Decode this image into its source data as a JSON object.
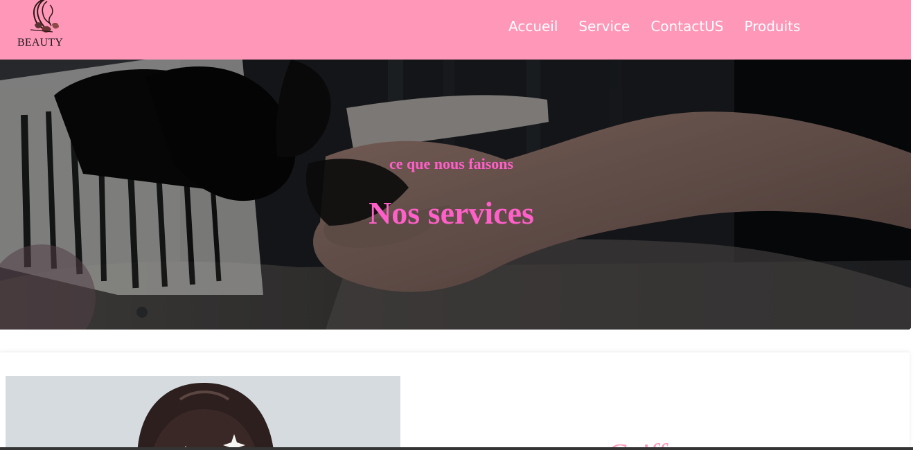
{
  "brand": {
    "name": "BEAUTY",
    "logo_icon": "woman-silhouette-logo-icon"
  },
  "nav": {
    "items": [
      {
        "label": "Accueil"
      },
      {
        "label": "Service"
      },
      {
        "label": "ContactUS"
      },
      {
        "label": "Produits"
      }
    ]
  },
  "hero": {
    "kicker": "ce que nous faisons",
    "title": "Nos services",
    "image_icon": "manicure-photo"
  },
  "service": {
    "title_visible": "Coiff",
    "image_icon": "hair-portrait-photo"
  },
  "colors": {
    "header": "#ff97b9",
    "hero_text": "#ff5fc8",
    "nav_text": "#ffffff",
    "service_title": "#ff9ab9"
  }
}
